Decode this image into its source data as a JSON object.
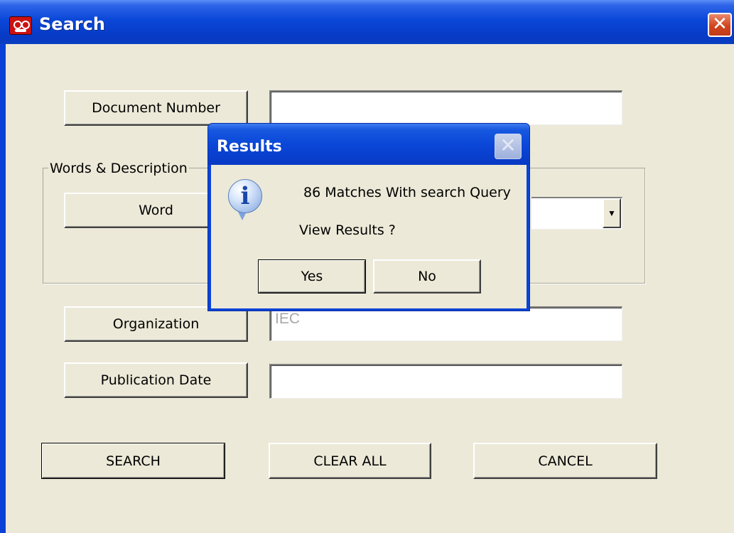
{
  "window": {
    "title": "Search",
    "close_glyph": "✕"
  },
  "form": {
    "document_number": {
      "label": "Document Number",
      "value": ""
    },
    "group_title": "Words & Description",
    "word": {
      "label": "Word"
    },
    "organization": {
      "label": "Organization",
      "value": "IEC"
    },
    "publication_date": {
      "label": "Publication Date",
      "value": ""
    },
    "combo_arrow_glyph": "▼"
  },
  "actions": {
    "search": "SEARCH",
    "clear_all": "CLEAR ALL",
    "cancel": "CANCEL"
  },
  "dialog": {
    "title": "Results",
    "close_glyph": "✕",
    "icon_glyph": "i",
    "message": "86 Matches With search Query",
    "question": "View Results ?",
    "yes": "Yes",
    "no": "No"
  }
}
